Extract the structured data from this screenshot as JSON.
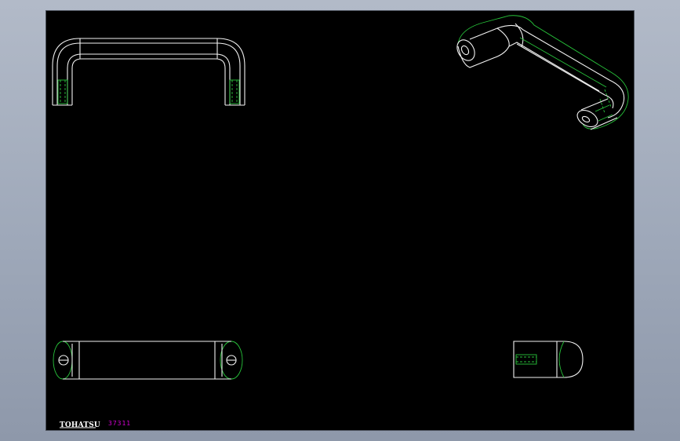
{
  "titleblock": {
    "logo": "TOHATSU",
    "part_number": "37311"
  },
  "colors": {
    "background": "#000000",
    "line_visible": "#f2f2f2",
    "line_hidden": "#27c23a",
    "part_number": "#d800d8",
    "frame": "#9ea8b9"
  },
  "views": [
    "front-view",
    "isometric-view",
    "top-view",
    "side-view"
  ]
}
